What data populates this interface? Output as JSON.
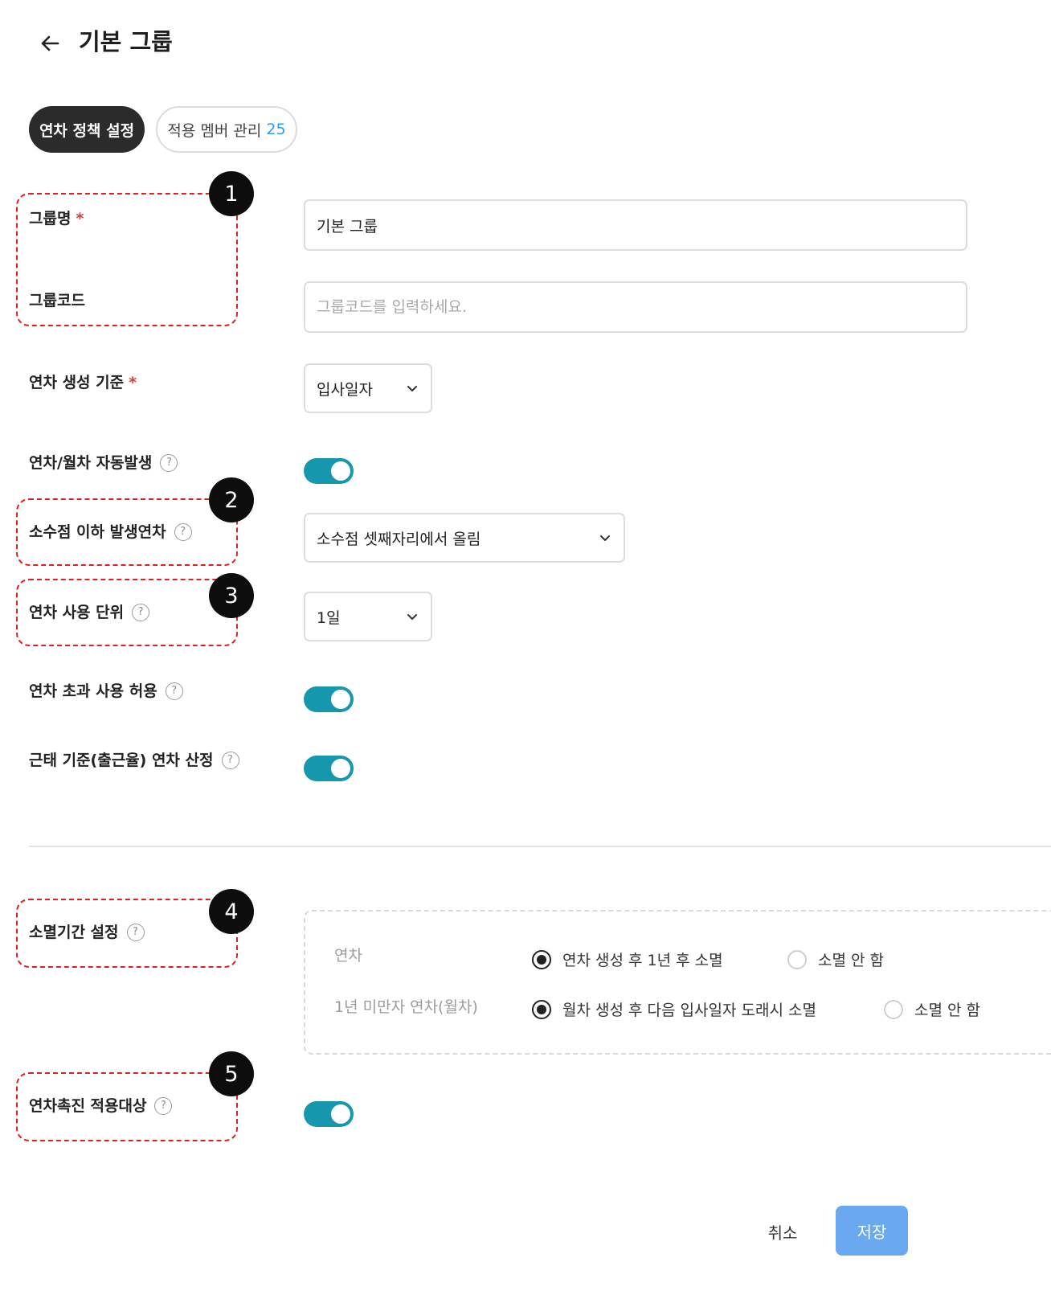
{
  "header": {
    "title": "기본 그룹"
  },
  "tabs": [
    {
      "label": "연차 정책 설정"
    },
    {
      "label": "적용 멤버 관리",
      "count": "25"
    }
  ],
  "form": {
    "group_name": {
      "label": "그룹명",
      "required": "*",
      "value": "기본 그룹"
    },
    "group_code": {
      "label": "그룹코드",
      "placeholder": "그룹코드를 입력하세요."
    },
    "leave_basis": {
      "label": "연차 생성 기준",
      "required": "*",
      "selected": "입사일자"
    },
    "auto_generate": {
      "label": "연차/월차 자동발생",
      "help": "?",
      "enabled": true
    },
    "decimal_leave": {
      "label": "소수점 이하 발생연차",
      "help": "?",
      "selected": "소수점 셋째자리에서 올림"
    },
    "usage_unit": {
      "label": "연차 사용 단위",
      "help": "?",
      "selected": "1일"
    },
    "allow_excess": {
      "label": "연차 초과 사용 허용",
      "help": "?",
      "enabled": true
    },
    "attendance_based": {
      "label": "근태 기준(출근율) 연차 산정",
      "help": "?",
      "enabled": true
    },
    "expiry": {
      "label": "소멸기간 설정",
      "help": "?",
      "rows": [
        {
          "label": "연차",
          "option_a": "연차 생성 후 1년 후 소멸",
          "option_b": "소멸 안 함",
          "selected": "option_a"
        },
        {
          "label": "1년 미만자 연차(월차)",
          "option_a": "월차 생성 후 다음 입사일자 도래시 소멸",
          "option_b": "소멸 안 함",
          "selected": "option_a"
        }
      ]
    },
    "promotion_target": {
      "label": "연차촉진 적용대상",
      "help": "?",
      "enabled": true
    }
  },
  "annotations": [
    "1",
    "2",
    "3",
    "4",
    "5"
  ],
  "footer": {
    "cancel_label": "취소",
    "save_label": "저장"
  },
  "colors": {
    "toggle_on": "#1597ad",
    "save_button": "#6aa8ef",
    "tab_count": "#2d9cf0",
    "required": "#e53935",
    "annotation": "#e02020"
  }
}
